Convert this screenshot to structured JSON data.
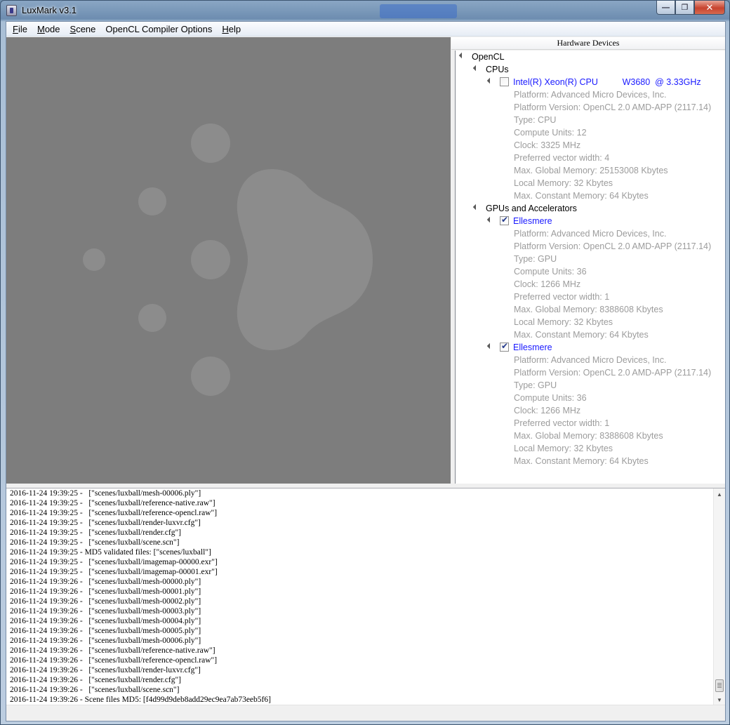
{
  "window": {
    "title": "LuxMark v3.1",
    "minimize": "—",
    "maximize": "❐",
    "close": "✕"
  },
  "menu": [
    {
      "prefix": "",
      "accel": "F",
      "rest": "ile"
    },
    {
      "prefix": "",
      "accel": "M",
      "rest": "ode"
    },
    {
      "prefix": "",
      "accel": "S",
      "rest": "cene"
    },
    {
      "prefix": "OpenCL Compiler Options",
      "accel": "",
      "rest": ""
    },
    {
      "prefix": "",
      "accel": "H",
      "rest": "elp"
    }
  ],
  "hardware": {
    "header": "Hardware Devices",
    "root": "OpenCL",
    "cpus_label": "CPUs",
    "gpus_label": "GPUs and Accelerators",
    "cpu": {
      "name": "Intel(R) Xeon(R) CPU          W3680  @ 3.33GHz",
      "checked": false,
      "props": [
        "Platform: Advanced Micro Devices, Inc.",
        "Platform Version: OpenCL 2.0 AMD-APP (2117.14)",
        "Type: CPU",
        "Compute Units: 12",
        "Clock: 3325 MHz",
        "Preferred vector width: 4",
        "Max. Global Memory: 25153008 Kbytes",
        "Local Memory: 32 Kbytes",
        "Max. Constant Memory: 64 Kbytes"
      ]
    },
    "gpus": [
      {
        "name": "Ellesmere",
        "checked": true,
        "props": [
          "Platform: Advanced Micro Devices, Inc.",
          "Platform Version: OpenCL 2.0 AMD-APP (2117.14)",
          "Type: GPU",
          "Compute Units: 36",
          "Clock: 1266 MHz",
          "Preferred vector width: 1",
          "Max. Global Memory: 8388608 Kbytes",
          "Local Memory: 32 Kbytes",
          "Max. Constant Memory: 64 Kbytes"
        ]
      },
      {
        "name": "Ellesmere",
        "checked": true,
        "props": [
          "Platform: Advanced Micro Devices, Inc.",
          "Platform Version: OpenCL 2.0 AMD-APP (2117.14)",
          "Type: GPU",
          "Compute Units: 36",
          "Clock: 1266 MHz",
          "Preferred vector width: 1",
          "Max. Global Memory: 8388608 Kbytes",
          "Local Memory: 32 Kbytes",
          "Max. Constant Memory: 64 Kbytes"
        ]
      }
    ]
  },
  "log": [
    "2016-11-24 19:39:25 -   [\"scenes/luxball/mesh-00006.ply\"]",
    "2016-11-24 19:39:25 -   [\"scenes/luxball/reference-native.raw\"]",
    "2016-11-24 19:39:25 -   [\"scenes/luxball/reference-opencl.raw\"]",
    "2016-11-24 19:39:25 -   [\"scenes/luxball/render-luxvr.cfg\"]",
    "2016-11-24 19:39:25 -   [\"scenes/luxball/render.cfg\"]",
    "2016-11-24 19:39:25 -   [\"scenes/luxball/scene.scn\"]",
    "2016-11-24 19:39:25 - MD5 validated files: [\"scenes/luxball\"]",
    "2016-11-24 19:39:25 -   [\"scenes/luxball/imagemap-00000.exr\"]",
    "2016-11-24 19:39:25 -   [\"scenes/luxball/imagemap-00001.exr\"]",
    "2016-11-24 19:39:26 -   [\"scenes/luxball/mesh-00000.ply\"]",
    "2016-11-24 19:39:26 -   [\"scenes/luxball/mesh-00001.ply\"]",
    "2016-11-24 19:39:26 -   [\"scenes/luxball/mesh-00002.ply\"]",
    "2016-11-24 19:39:26 -   [\"scenes/luxball/mesh-00003.ply\"]",
    "2016-11-24 19:39:26 -   [\"scenes/luxball/mesh-00004.ply\"]",
    "2016-11-24 19:39:26 -   [\"scenes/luxball/mesh-00005.ply\"]",
    "2016-11-24 19:39:26 -   [\"scenes/luxball/mesh-00006.ply\"]",
    "2016-11-24 19:39:26 -   [\"scenes/luxball/reference-native.raw\"]",
    "2016-11-24 19:39:26 -   [\"scenes/luxball/reference-opencl.raw\"]",
    "2016-11-24 19:39:26 -   [\"scenes/luxball/render-luxvr.cfg\"]",
    "2016-11-24 19:39:26 -   [\"scenes/luxball/render.cfg\"]",
    "2016-11-24 19:39:26 -   [\"scenes/luxball/scene.scn\"]",
    "2016-11-24 19:39:26 - Scene files MD5: [f4d99d9deb8add29ec9ea7ab73eeb5f6]"
  ],
  "colors": {
    "device_text": "#1a1aff",
    "prop_text": "#9c9c9c",
    "render_bg": "#7d7d7d",
    "logo_fill": "#8c8c8c"
  }
}
